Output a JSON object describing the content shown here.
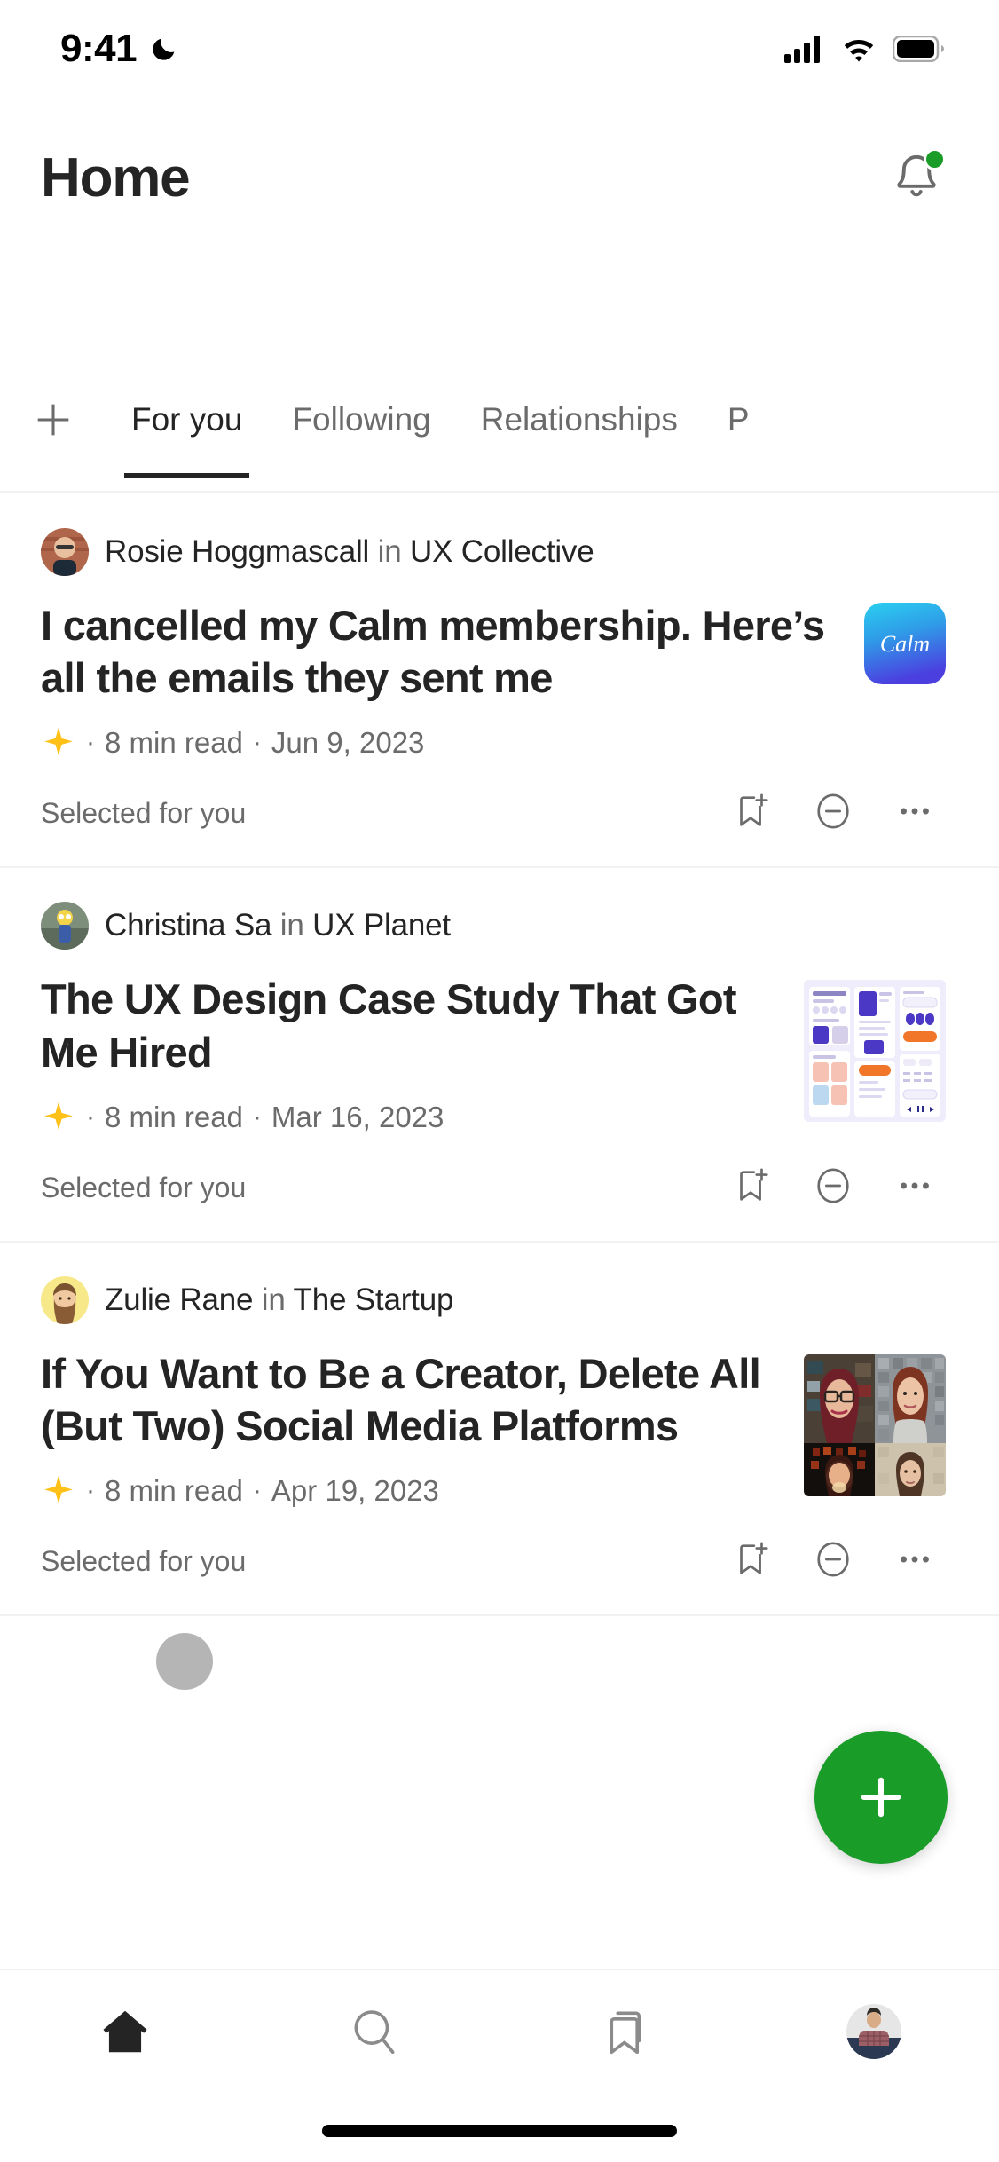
{
  "status_bar": {
    "time": "9:41",
    "dnd_icon": "moon-icon",
    "signal_icon": "cellular-signal-icon",
    "wifi_icon": "wifi-icon",
    "battery_icon": "battery-full-icon"
  },
  "header": {
    "title": "Home",
    "notifications_icon": "bell-icon",
    "has_unread_badge": true,
    "badge_color": "#1a9c29"
  },
  "tabs": {
    "add_icon": "plus-icon",
    "items": [
      {
        "label": "For you",
        "active": true
      },
      {
        "label": "Following",
        "active": false
      },
      {
        "label": "Relationships",
        "active": false
      },
      {
        "label": "P",
        "active": false
      }
    ]
  },
  "feed": {
    "articles": [
      {
        "author": "Rosie Hoggmascall",
        "in_word": "in",
        "publication": "UX Collective",
        "title": "I cancelled my Calm membership. Here’s all the emails they sent me",
        "member_only_icon": "star-icon",
        "read_time": "8  min read",
        "date": "Jun 9, 2023",
        "recommendation_reason": "Selected for you",
        "thumbnail_type": "calm-app-logo",
        "thumbnail_label": "Calm",
        "actions": [
          "bookmark-add-icon",
          "show-less-icon",
          "more-options-icon"
        ]
      },
      {
        "author": "Christina Sa",
        "in_word": "in",
        "publication": "UX Planet",
        "title": "The UX Design Case Study That Got Me Hired",
        "member_only_icon": "star-icon",
        "read_time": "8  min read",
        "date": "Mar 16, 2023",
        "recommendation_reason": "Selected for you",
        "thumbnail_type": "ui-mockup-collage",
        "thumbnail_label": "",
        "actions": [
          "bookmark-add-icon",
          "show-less-icon",
          "more-options-icon"
        ]
      },
      {
        "author": "Zulie Rane",
        "in_word": "in",
        "publication": "The Startup",
        "title": "If You Want to Be a Creator, Delete All (But Two) Social Media Platforms",
        "member_only_icon": "star-icon",
        "read_time": "8  min read",
        "date": "Apr 19, 2023",
        "recommendation_reason": "Selected for you",
        "thumbnail_type": "portrait-grid",
        "thumbnail_label": "",
        "actions": [
          "bookmark-add-icon",
          "show-less-icon",
          "more-options-icon"
        ]
      }
    ]
  },
  "fab": {
    "icon": "plus-icon",
    "color": "#1a9c29"
  },
  "bottom_nav": {
    "items": [
      {
        "name": "home",
        "icon": "home-icon",
        "active": true
      },
      {
        "name": "search",
        "icon": "search-icon",
        "active": false
      },
      {
        "name": "library",
        "icon": "bookmark-icon",
        "active": false
      },
      {
        "name": "profile",
        "icon": "avatar-icon",
        "active": false
      }
    ]
  },
  "colors": {
    "accent_green": "#1a9c29",
    "text_primary": "#242424",
    "text_secondary": "#6b6b6b",
    "star_yellow": "#ffc017",
    "divider": "#f2f2f2"
  }
}
